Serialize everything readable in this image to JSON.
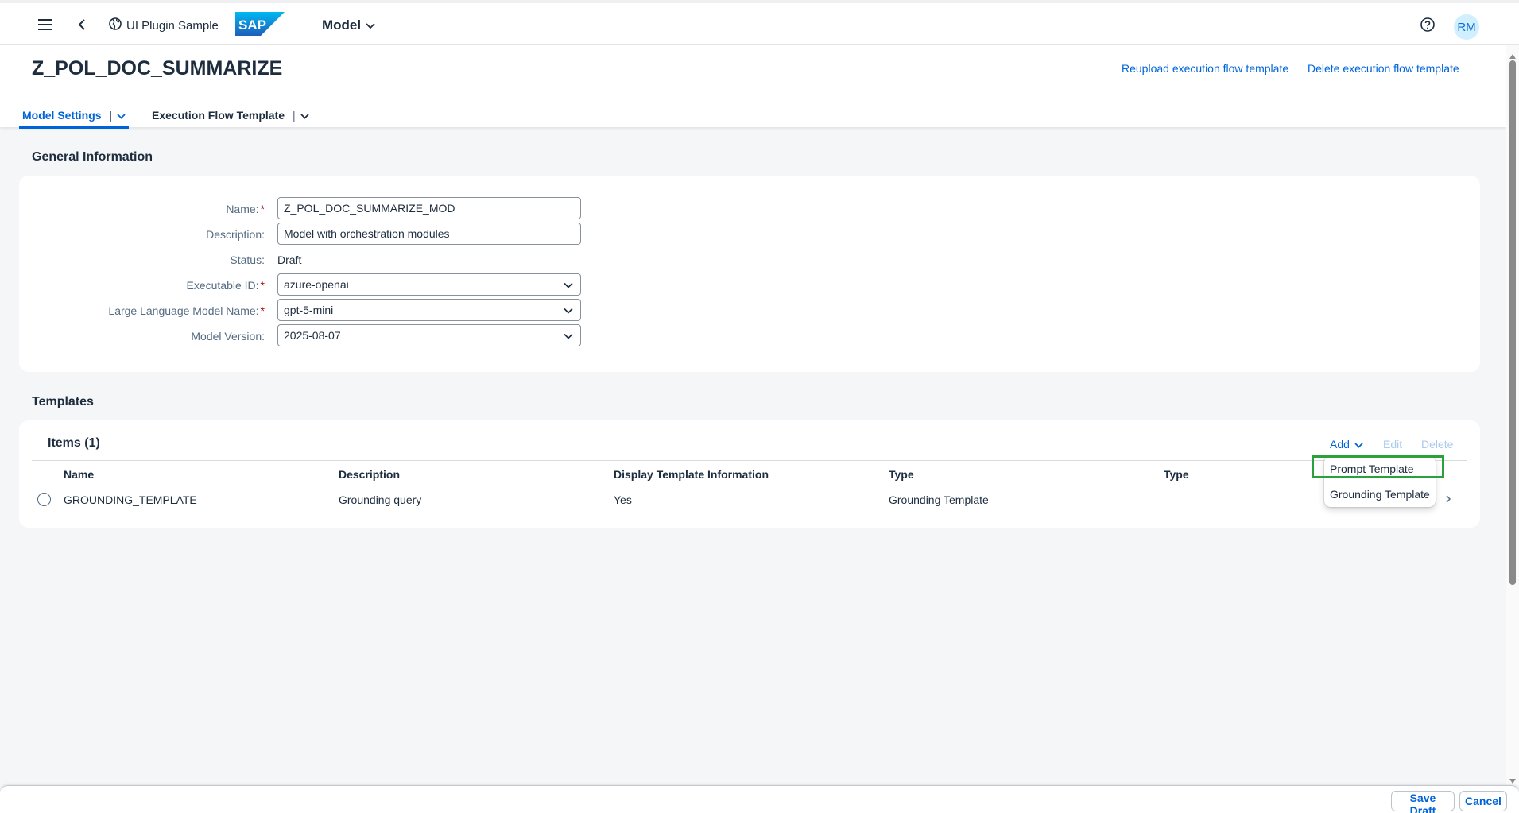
{
  "shell": {
    "app_name": "UI Plugin Sample",
    "logo_text": "SAP",
    "menu_title": "Model",
    "avatar_initials": "RM"
  },
  "header": {
    "title": "Z_POL_DOC_SUMMARIZE",
    "actions": {
      "reupload": "Reupload execution flow template",
      "delete": "Delete execution flow template"
    },
    "tabs": [
      {
        "label": "Model Settings",
        "selected": true
      },
      {
        "label": "Execution Flow Template",
        "selected": false
      }
    ]
  },
  "general": {
    "section_title": "General Information",
    "fields": {
      "name": {
        "label": "Name:",
        "value": "Z_POL_DOC_SUMMARIZE_MOD",
        "required": true
      },
      "description": {
        "label": "Description:",
        "value": "Model with orchestration modules"
      },
      "status": {
        "label": "Status:",
        "value": "Draft"
      },
      "executable_id": {
        "label": "Executable ID:",
        "value": "azure-openai",
        "required": true
      },
      "llm_name": {
        "label": "Large Language Model Name:",
        "value": "gpt-5-mini",
        "required": true
      },
      "model_version": {
        "label": "Model Version:",
        "value": "2025-08-07"
      }
    }
  },
  "templates": {
    "section_title": "Templates",
    "items_title": "Items (1)",
    "toolbar": {
      "add": "Add",
      "edit": "Edit",
      "delete": "Delete"
    },
    "columns": [
      "Name",
      "Description",
      "Display Template Information",
      "Type",
      "Type"
    ],
    "rows": [
      {
        "name": "GROUNDING_TEMPLATE",
        "description": "Grounding query",
        "display_info": "Yes",
        "type": "Grounding Template"
      }
    ],
    "add_menu": [
      "Prompt Template",
      "Grounding Template"
    ]
  },
  "footer": {
    "save_draft": "Save Draft",
    "cancel": "Cancel"
  },
  "colors": {
    "accent": "#0064d9",
    "required": "#aa0808",
    "highlight": "#2aa13b"
  }
}
